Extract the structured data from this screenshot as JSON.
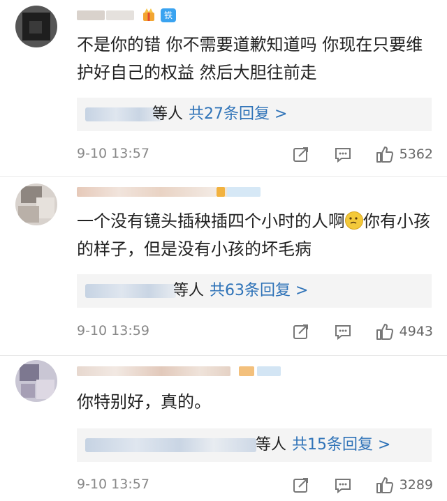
{
  "comments": [
    {
      "badge": "铁粉",
      "text": "不是你的错 你不需要道歉知道吗 你现在只要维护好自己的权益 然后大胆往前走",
      "reply_suffix": "等人",
      "reply_count": "共27条回复 >",
      "time": "9-10 13:57",
      "likes": "5362"
    },
    {
      "text_before_emoji": "一个没有镜头插秧插四个小时的人啊",
      "emoji": "worried-face-emoji",
      "text_after_emoji": "你有小孩的样子，但是没有小孩的坏毛病",
      "reply_suffix": "等人",
      "reply_count": "共63条回复 >",
      "time": "9-10 13:59",
      "likes": "4943"
    },
    {
      "text": "你特别好，真的。",
      "reply_suffix": "等人",
      "reply_count": "共15条回复 >",
      "time": "9-10 13:57",
      "likes": "3289"
    }
  ],
  "icons": {
    "repost": "share-square-icon",
    "comment": "comment-dots-icon",
    "like": "thumbs-up-icon",
    "fan_badge": "gift-crown-icon"
  },
  "colors": {
    "link": "#2f73b8",
    "badge": "#3aa3f0",
    "meta": "#888888",
    "reply_bg": "#f4f4f4"
  }
}
